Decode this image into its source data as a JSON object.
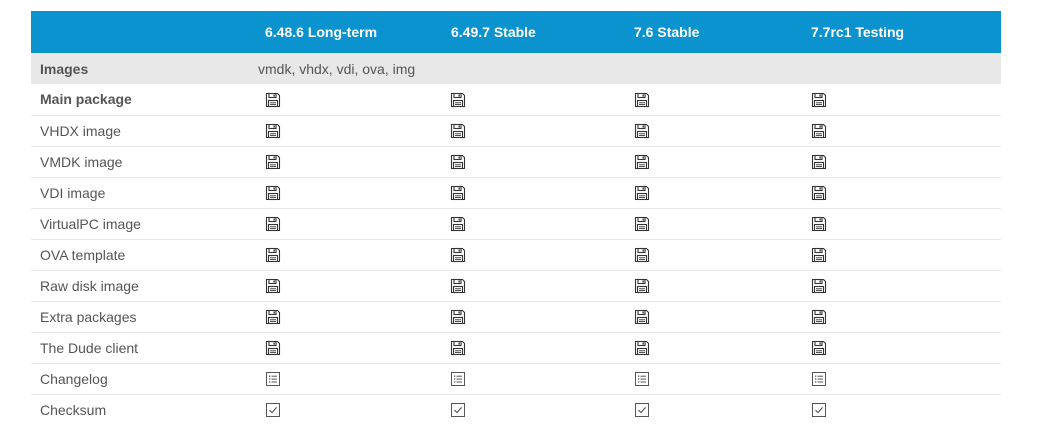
{
  "header": {
    "blank": "",
    "versions": [
      "6.48.6 Long-term",
      "6.49.7 Stable",
      "7.6 Stable",
      "7.7rc1 Testing"
    ]
  },
  "section": {
    "title": "Images",
    "formats": "vmdk, vhdx, vdi, ova, img"
  },
  "rows": [
    {
      "label": "Main package",
      "icon": "floppy-disk-icon"
    },
    {
      "label": "VHDX image",
      "icon": "floppy-disk-icon"
    },
    {
      "label": "VMDK image",
      "icon": "floppy-disk-icon"
    },
    {
      "label": "VDI image",
      "icon": "floppy-disk-icon"
    },
    {
      "label": "VirtualPC image",
      "icon": "floppy-disk-icon"
    },
    {
      "label": "OVA template",
      "icon": "floppy-disk-icon"
    },
    {
      "label": "Raw disk image",
      "icon": "floppy-disk-icon"
    },
    {
      "label": "Extra packages",
      "icon": "floppy-disk-icon"
    },
    {
      "label": "The Dude client",
      "icon": "floppy-disk-icon"
    },
    {
      "label": "Changelog",
      "icon": "list-icon"
    },
    {
      "label": "Checksum",
      "icon": "checkbox-icon"
    }
  ],
  "colors": {
    "header_bg": "#0a93cf",
    "header_text": "#ffffff",
    "section_bg": "#e8e8e8",
    "row_divider": "#e6e6e6",
    "icon_stroke": "#333333"
  }
}
